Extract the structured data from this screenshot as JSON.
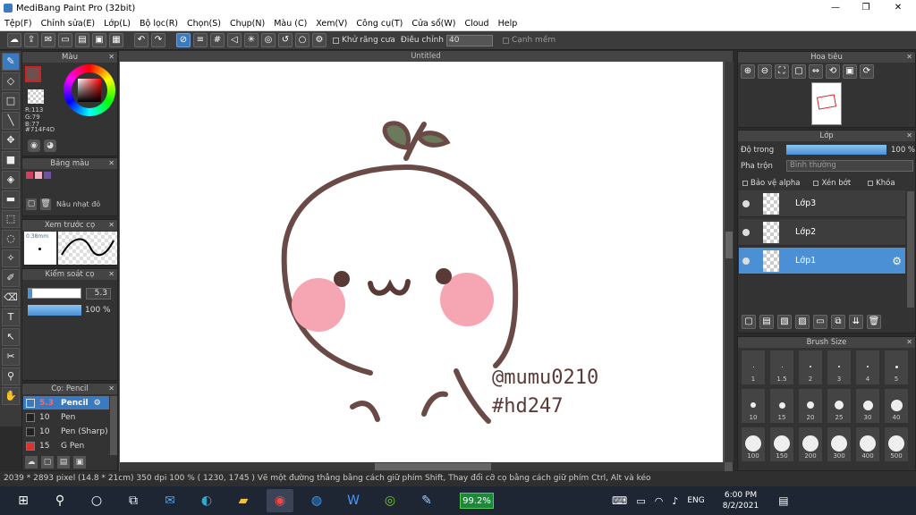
{
  "app": {
    "title": "MediBang Paint Pro (32bit)",
    "minimize": "—",
    "maximize": "❐",
    "close": "✕"
  },
  "menu": [
    "Tệp(F)",
    "Chỉnh sửa(E)",
    "Lớp(L)",
    "Bộ lọc(R)",
    "Chọn(S)",
    "Chụp(N)",
    "Màu (C)",
    "Xem(V)",
    "Công cụ(T)",
    "Cửa sổ(W)",
    "Cloud",
    "Help"
  ],
  "toolbar": {
    "antialias_label": "Khử răng cưa",
    "adjust_label": "Điều chỉnh",
    "adjust_value": "40",
    "smooth_label": "Cạnh mềm"
  },
  "color_panel": {
    "title": "Màu",
    "r": "R:113",
    "g": "G:79",
    "b": "B:77",
    "hex": "#714F4D",
    "fg": "#714f4d"
  },
  "palette_panel": {
    "title": "Bảng màu",
    "swatches": [
      "#d04060",
      "#f0b0c0",
      "#7050a0"
    ]
  },
  "adjust_panel": {
    "label": "Nâu nhạt đỏ"
  },
  "preview_panel": {
    "title": "Xem trước cọ",
    "size": "0.38mm"
  },
  "brush_control": {
    "title": "Kiểm soát cọ",
    "size": "5.3",
    "opacity": "100 %"
  },
  "brush_list": {
    "title": "Cọ: Pencil",
    "items": [
      {
        "size": "5.3",
        "name": "Pencil",
        "color": "#3c7ac0"
      },
      {
        "size": "10",
        "name": "Pen",
        "color": "#222"
      },
      {
        "size": "10",
        "name": "Pen (Sharp)",
        "color": "#222"
      },
      {
        "size": "15",
        "name": "G Pen",
        "color": "#e03030"
      }
    ]
  },
  "document": {
    "title": "Untitled"
  },
  "navigator": {
    "title": "Hoa tiêu"
  },
  "layer_panel": {
    "title": "Lớp",
    "opacity_label": "Độ trong",
    "opacity_value": "100 %",
    "blend_label": "Pha trộn",
    "blend_value": "Bình thường",
    "protect_alpha": "Bảo vệ alpha",
    "clip": "Xén bớt",
    "lock": "Khóa",
    "layers": [
      "Lớp3",
      "Lớp2",
      "Lớp1"
    ]
  },
  "brush_size": {
    "title": "Brush Size",
    "sizes": [
      "1",
      "1.5",
      "2",
      "3",
      "4",
      "5",
      "10",
      "15",
      "20",
      "25",
      "30",
      "40",
      "100",
      "150",
      "200",
      "300",
      "400",
      "500"
    ]
  },
  "status": {
    "text": "2039 * 2893 pixel   (14.8 * 21cm)   350 dpi   100 %   ( 1230, 1745 )   Vẽ một đường thẳng bằng cách giữ phím Shift, Thay đổi cỡ cọ bằng cách giữ phím Ctrl, Alt và kéo"
  },
  "artwork": {
    "signature1": "@mumu0210",
    "signature2": "#hd247"
  },
  "taskbar": {
    "battery": "99.2%",
    "lang": "ENG",
    "time": "6:00 PM",
    "date": "8/2/2021"
  }
}
